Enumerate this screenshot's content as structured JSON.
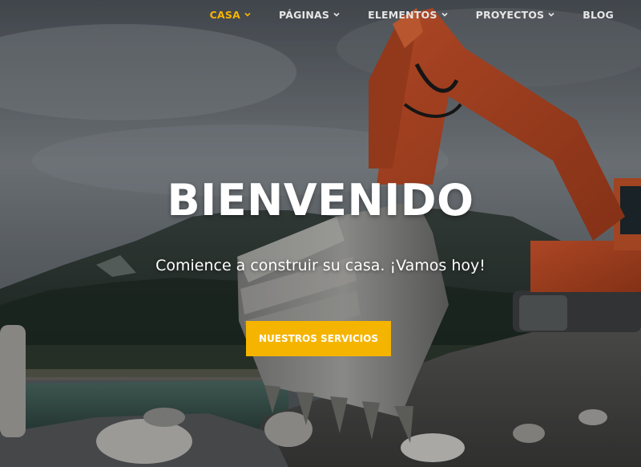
{
  "nav": {
    "items": [
      {
        "label": "CASA",
        "active": true,
        "has_dropdown": true
      },
      {
        "label": "PÁGINAS",
        "active": false,
        "has_dropdown": true
      },
      {
        "label": "ELEMENTOS",
        "active": false,
        "has_dropdown": true
      },
      {
        "label": "PROYECTOS",
        "active": false,
        "has_dropdown": true
      },
      {
        "label": "BLOG",
        "active": false,
        "has_dropdown": false
      }
    ],
    "active_color": "#f5b400",
    "text_color": "#e6e6e6"
  },
  "hero": {
    "title": "BIENVENIDO",
    "subtitle": "Comience a construir su casa. ¡Vamos hoy!",
    "cta_label": "NUESTROS SERVICIOS",
    "accent": "#f5b400",
    "background_image": "excavator-at-riverside-mountains"
  }
}
